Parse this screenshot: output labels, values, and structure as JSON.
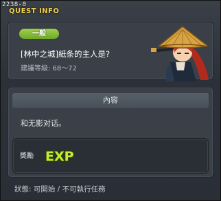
{
  "window": {
    "id_tag": "2238-0",
    "title": "QUEST INFO"
  },
  "quest": {
    "level_badge": "一般",
    "name": "[林中之城]紙条的主人是?",
    "level_range": "建議等級: 68～72",
    "npc_icon": "samurai-straw-hat-npc-portrait"
  },
  "content": {
    "header": "內容",
    "text": "和无影对话。"
  },
  "reward": {
    "label": "獎勵",
    "exp_text": "EXP",
    "exp_colors": {
      "fill": "#c8ee2e",
      "outline": "#2a4a00"
    }
  },
  "status": "狀態: 可開始 / 不可執行任務",
  "colors": {
    "accent_title": "#f2d24a",
    "badge": "#8cc63f",
    "panel": "#3b4048"
  }
}
